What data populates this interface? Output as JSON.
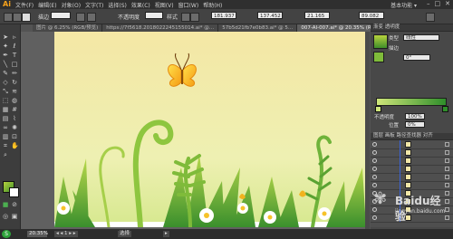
{
  "app": {
    "logo": "Ai"
  },
  "menubar": {
    "items": [
      "文件(F)",
      "编辑(E)",
      "对象(O)",
      "文字(T)",
      "选择(S)",
      "效果(C)",
      "视图(V)",
      "窗口(W)",
      "帮助(H)"
    ],
    "workspace": "基本功能 ▾",
    "window_controls": [
      "–",
      "□",
      "✕"
    ]
  },
  "controlbar": {
    "stroke_label": "描边",
    "opacity_label": "不透明度",
    "style_label": "样式",
    "x_value": "181.937",
    "y_value": "137.452",
    "w_value": "21.165",
    "h_value": "89.082"
  },
  "tabs": [
    {
      "label": "图片 @ 6.25% (RGB/预览)"
    },
    {
      "label": "https://7f5618.2018022245155014.ai* @…"
    },
    {
      "label": "57b5d21fb7e0b83.ai* @ 5…"
    },
    {
      "label": "007-AI-007.ai* @ 20.35% (RGB/预览)"
    }
  ],
  "right_panel": {
    "header": "渐变  透明度",
    "type_label": "类型",
    "type_value": "线性",
    "stroke_label": "描边",
    "angle_value": "0°",
    "opacity_label": "不透明度",
    "opacity_value": "100%",
    "position_label": "位置",
    "position_value": "0%",
    "layers_header": "图层  画板  路径查找器  对齐"
  },
  "layers": {
    "row_count": 11
  },
  "statusbar": {
    "zoom": "20.35%",
    "segments": [
      "◂ ◂  1  ▸ ▸",
      "选择",
      "▸"
    ]
  },
  "watermark": {
    "text": "Baidu经验",
    "sub": "jingyan.baidu.com"
  },
  "colors": {
    "menubar": "#2f2f2f",
    "panel": "#484848",
    "accent_orange": "#f7a21b",
    "sky_top": "#f3e6a4",
    "grass_dark": "#3f8f2a",
    "grass_light": "#b7d23e"
  }
}
